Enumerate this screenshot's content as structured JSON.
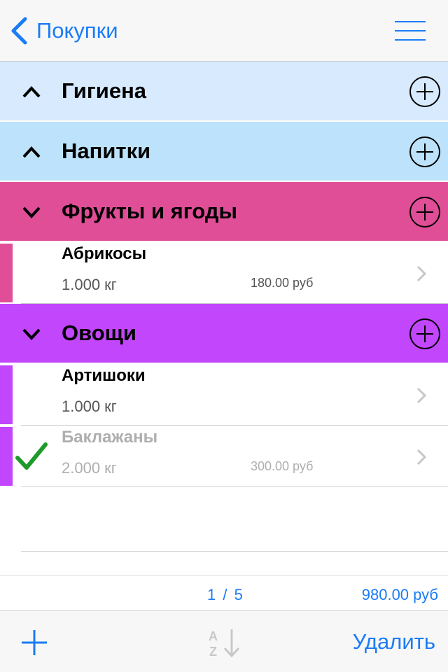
{
  "nav": {
    "back_label": "Покупки"
  },
  "sections": [
    {
      "title": "Гигиена",
      "color": "#d7eafe",
      "chevron": "chevron-up-icon",
      "items": []
    },
    {
      "title": "Напитки",
      "color": "#bde3fc",
      "chevron": "chevron-up-icon",
      "items": []
    },
    {
      "title": "Фрукты и ягоды",
      "color": "#e04e98",
      "chevron": "chevron-down-icon",
      "items": [
        {
          "name": "Абрикосы",
          "qty": "1.000 кг",
          "price": "180.00 руб",
          "done": false
        }
      ]
    },
    {
      "title": "Овощи",
      "color": "#c246fb",
      "chevron": "chevron-down-icon",
      "items": [
        {
          "name": "Артишоки",
          "qty": "1.000 кг",
          "price": "",
          "done": false
        },
        {
          "name": "Баклажаны",
          "qty": "2.000 кг",
          "price": "300.00 руб",
          "done": true
        }
      ]
    }
  ],
  "summary": {
    "count": "1 / 5",
    "total": "980.00 руб"
  },
  "toolbar": {
    "add_icon": "plus-icon",
    "sort_icon": "sort-az-icon",
    "delete_label": "Удалить"
  },
  "colors": {
    "accent": "#1a7cf6",
    "check": "#1e9a2a"
  }
}
